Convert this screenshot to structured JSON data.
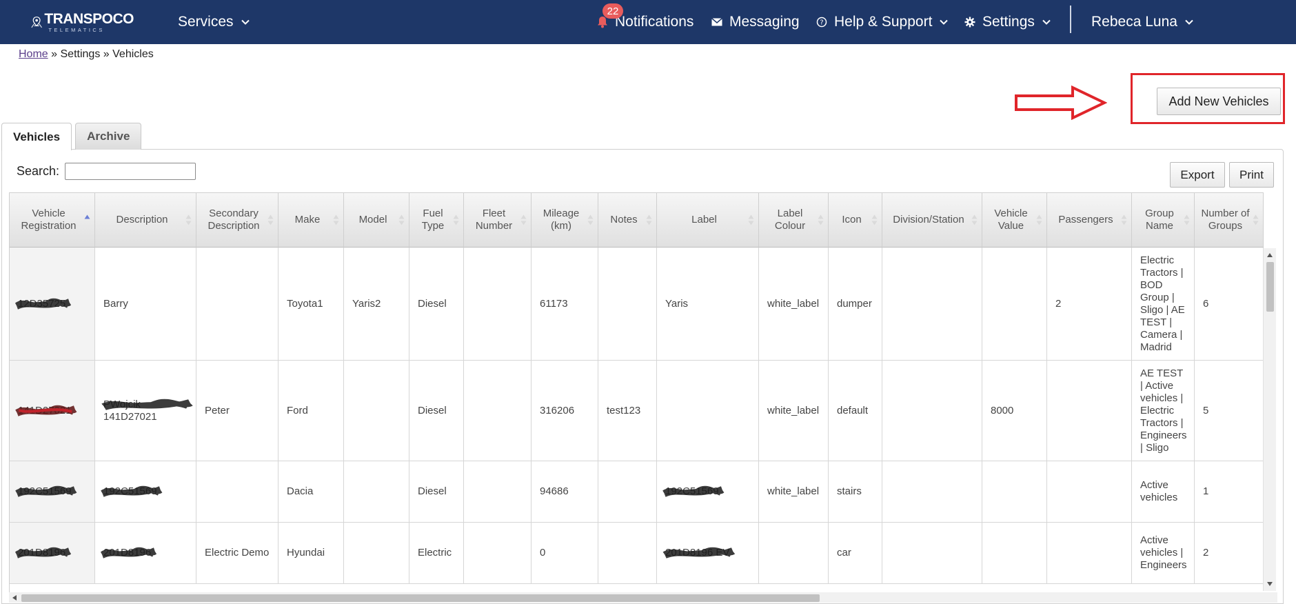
{
  "navbar": {
    "logo_brand": "TRANSPOCO",
    "logo_sub": "TELEMATICS",
    "services": "Services",
    "notifications": "Notifications",
    "notifications_count": "22",
    "messaging": "Messaging",
    "help": "Help & Support",
    "settings": "Settings",
    "user": "Rebeca Luna",
    "colors": {
      "background": "#1e3768",
      "badge": "#e85c5c"
    }
  },
  "breadcrumb": {
    "home": "Home",
    "sep": "»",
    "settings": "Settings",
    "current": "Vehicles"
  },
  "actions": {
    "add_new_vehicles": "Add New Vehicles",
    "export": "Export",
    "print": "Print"
  },
  "annotation": {
    "color": "#e0252a"
  },
  "tabs": [
    {
      "label": "Vehicles",
      "active": true
    },
    {
      "label": "Archive",
      "active": false
    }
  ],
  "search": {
    "label": "Search:",
    "value": "",
    "placeholder": ""
  },
  "table": {
    "columns": [
      "Vehicle Registration",
      "Description",
      "Secondary Description",
      "Make",
      "Model",
      "Fuel Type",
      "Fleet Number",
      "Mileage (km)",
      "Notes",
      "Label",
      "Label Colour",
      "Icon",
      "Division/Station",
      "Vehicle Value",
      "Passengers",
      "Group Name",
      "Number of Groups"
    ],
    "rows": [
      [
        "12D35725",
        "Barry",
        "",
        "Toyota1",
        "Yaris2",
        "Diesel",
        "",
        "61173",
        "",
        "Yaris",
        "white_label",
        "dumper",
        "",
        "",
        "2",
        "Electric Tractors | BOD Group | Sligo | AE TEST | Camera | Madrid",
        "6"
      ],
      [
        "141D27021",
        "PWojcik 141D27021",
        "Peter",
        "Ford",
        "",
        "Diesel",
        "",
        "316206",
        "test123",
        "",
        "white_label",
        "default",
        "",
        "8000",
        "",
        "AE TEST | Active vehicles | Electric Tractors | Engineers | Sligo",
        "5"
      ],
      [
        "192C51569",
        "192C51569",
        "",
        "Dacia",
        "",
        "Diesel",
        "",
        "94686",
        "",
        "192C51569",
        "white_label",
        "stairs",
        "",
        "",
        "",
        "Active vehicles",
        "1"
      ],
      [
        "201D8196",
        "201D8196",
        "Electric Demo",
        "Hyundai",
        "",
        "Electric",
        "",
        "0",
        "",
        "201D8196 EV",
        "",
        "car",
        "",
        "",
        "",
        "Active vehicles | Engineers",
        "2"
      ]
    ]
  }
}
